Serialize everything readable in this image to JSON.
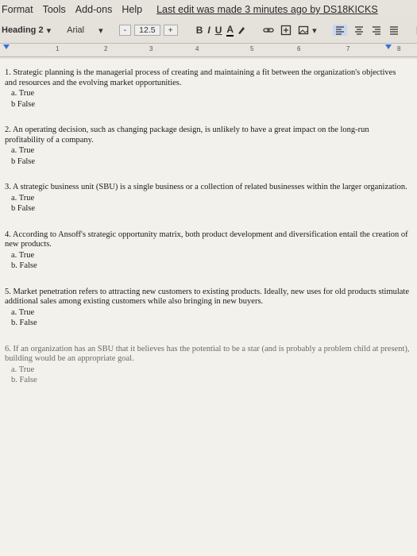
{
  "menu": {
    "format": "Format",
    "tools": "Tools",
    "addons": "Add-ons",
    "help": "Help",
    "last_edit": "Last edit was made 3 minutes ago by DS18KICKS"
  },
  "toolbar": {
    "style": "Heading 2",
    "font": "Arial",
    "minus": "-",
    "font_size": "12.5",
    "plus": "+",
    "bold": "B",
    "italic": "I",
    "underline": "U",
    "text_color": "A"
  },
  "ruler": {
    "marks": [
      "1",
      "2",
      "3",
      "4",
      "5",
      "6",
      "7",
      "8"
    ]
  },
  "questions": [
    {
      "text": "1.   Strategic planning is the managerial process of creating and maintaining a fit between the organization's objectives and resources and the evolving market opportunities.",
      "options": [
        "a. True",
        "b False"
      ]
    },
    {
      "text": "2.   An operating decision, such as changing package design, is unlikely to have a great impact on the long-run profitability of a company.",
      "options": [
        "a. True",
        "b False"
      ]
    },
    {
      "text": "3. A strategic business unit (SBU) is a single business or a collection of related businesses within the larger organization.",
      "options": [
        "a. True",
        "b False"
      ]
    },
    {
      "text": "4.   According to Ansoff's strategic opportunity matrix, both product development and diversification entail the creation of new products.",
      "options": [
        "a. True",
        "b. False"
      ]
    },
    {
      "text": "5.   Market penetration refers to attracting new customers to existing products. Ideally, new uses for old products stimulate additional sales among existing customers while also bringing in new buyers.",
      "options": [
        "a. True",
        "b. False"
      ]
    },
    {
      "text": "6.   If an organization has an SBU that it believes has the potential to be a star (and is probably a problem child at present), building would be an appropriate goal.",
      "options": [
        "a. True",
        "b. False"
      ]
    }
  ]
}
